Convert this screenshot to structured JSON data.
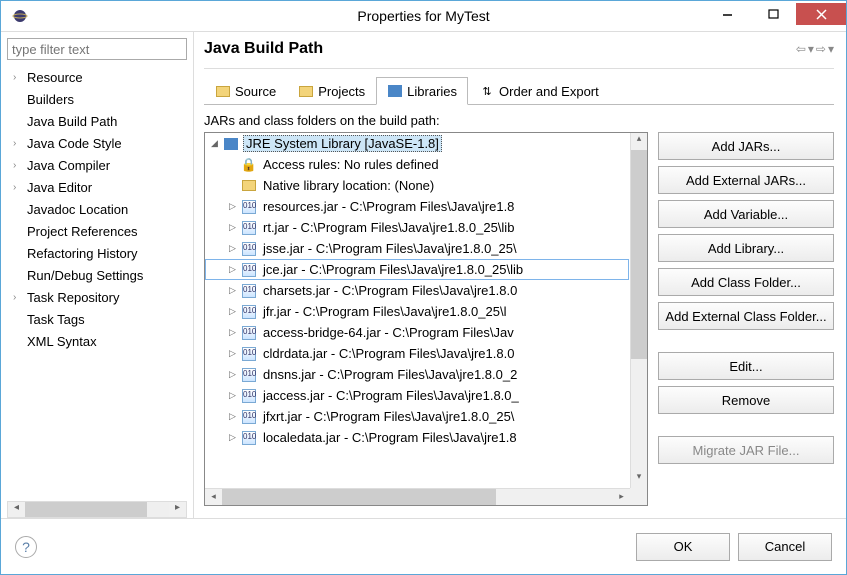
{
  "titlebar": {
    "title": "Properties for MyTest"
  },
  "filter_placeholder": "type filter text",
  "nav": [
    {
      "label": "Resource",
      "hasArrow": true
    },
    {
      "label": "Builders",
      "hasArrow": false
    },
    {
      "label": "Java Build Path",
      "hasArrow": false
    },
    {
      "label": "Java Code Style",
      "hasArrow": true
    },
    {
      "label": "Java Compiler",
      "hasArrow": true
    },
    {
      "label": "Java Editor",
      "hasArrow": true
    },
    {
      "label": "Javadoc Location",
      "hasArrow": false
    },
    {
      "label": "Project References",
      "hasArrow": false
    },
    {
      "label": "Refactoring History",
      "hasArrow": false
    },
    {
      "label": "Run/Debug Settings",
      "hasArrow": false
    },
    {
      "label": "Task Repository",
      "hasArrow": true
    },
    {
      "label": "Task Tags",
      "hasArrow": false
    },
    {
      "label": "XML Syntax",
      "hasArrow": false
    }
  ],
  "page_title": "Java Build Path",
  "tabs": {
    "source": "Source",
    "projects": "Projects",
    "libraries": "Libraries",
    "order": "Order and Export"
  },
  "subtitle": "JARs and class folders on the build path:",
  "tree": {
    "root": "JRE System Library [JavaSE-1.8]",
    "access": "Access rules: No rules defined",
    "native": "Native library location: (None)",
    "jars": [
      "resources.jar - C:\\Program Files\\Java\\jre1.8",
      "rt.jar - C:\\Program Files\\Java\\jre1.8.0_25\\lib",
      "jsse.jar - C:\\Program Files\\Java\\jre1.8.0_25\\",
      "jce.jar - C:\\Program Files\\Java\\jre1.8.0_25\\lib",
      "charsets.jar - C:\\Program Files\\Java\\jre1.8.0",
      "jfr.jar - C:\\Program Files\\Java\\jre1.8.0_25\\l",
      "access-bridge-64.jar - C:\\Program Files\\Jav",
      "cldrdata.jar - C:\\Program Files\\Java\\jre1.8.0",
      "dnsns.jar - C:\\Program Files\\Java\\jre1.8.0_2",
      "jaccess.jar - C:\\Program Files\\Java\\jre1.8.0_",
      "jfxrt.jar - C:\\Program Files\\Java\\jre1.8.0_25\\",
      "localedata.jar - C:\\Program Files\\Java\\jre1.8"
    ]
  },
  "buttons": {
    "add_jars": "Add JARs...",
    "add_ext_jars": "Add External JARs...",
    "add_var": "Add Variable...",
    "add_lib": "Add Library...",
    "add_cf": "Add Class Folder...",
    "add_ext_cf": "Add External Class Folder...",
    "edit": "Edit...",
    "remove": "Remove",
    "migrate": "Migrate JAR File..."
  },
  "footer": {
    "ok": "OK",
    "cancel": "Cancel"
  }
}
